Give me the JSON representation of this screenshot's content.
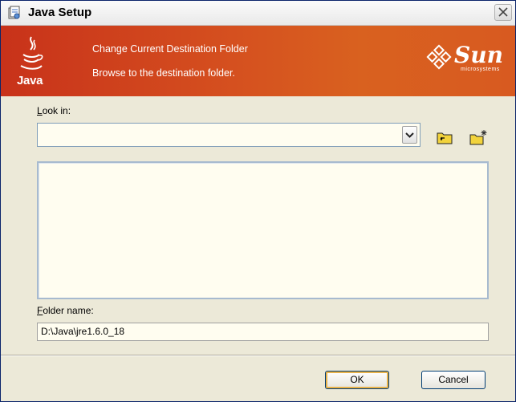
{
  "window": {
    "title": "Java Setup"
  },
  "banner": {
    "title": "Change Current Destination Folder",
    "subtitle": "Browse to the destination folder.",
    "java_logo_text": "Java",
    "sun_logo_text": "Sun",
    "sun_logo_subtext": "microsystems",
    "gradient_colors": [
      "#c8321a",
      "#d9611f"
    ]
  },
  "form": {
    "look_in_label_prefix": "L",
    "look_in_label_rest": "ook in:",
    "look_in_value": "",
    "folder_list_items": [],
    "folder_name_label_prefix": "F",
    "folder_name_label_rest": "older name:",
    "folder_name_value": "D:\\Java\\jre1.6.0_18"
  },
  "buttons": {
    "ok": "OK",
    "cancel": "Cancel"
  },
  "icons": {
    "app": "java-setup-icon",
    "close": "close-icon",
    "dropdown": "chevron-down-icon",
    "up_folder": "up-folder-icon",
    "new_folder": "new-folder-icon"
  },
  "colors": {
    "accent_border": "#003c74",
    "field_bg": "#fffdf0",
    "dialog_bg": "#ece9d8"
  }
}
